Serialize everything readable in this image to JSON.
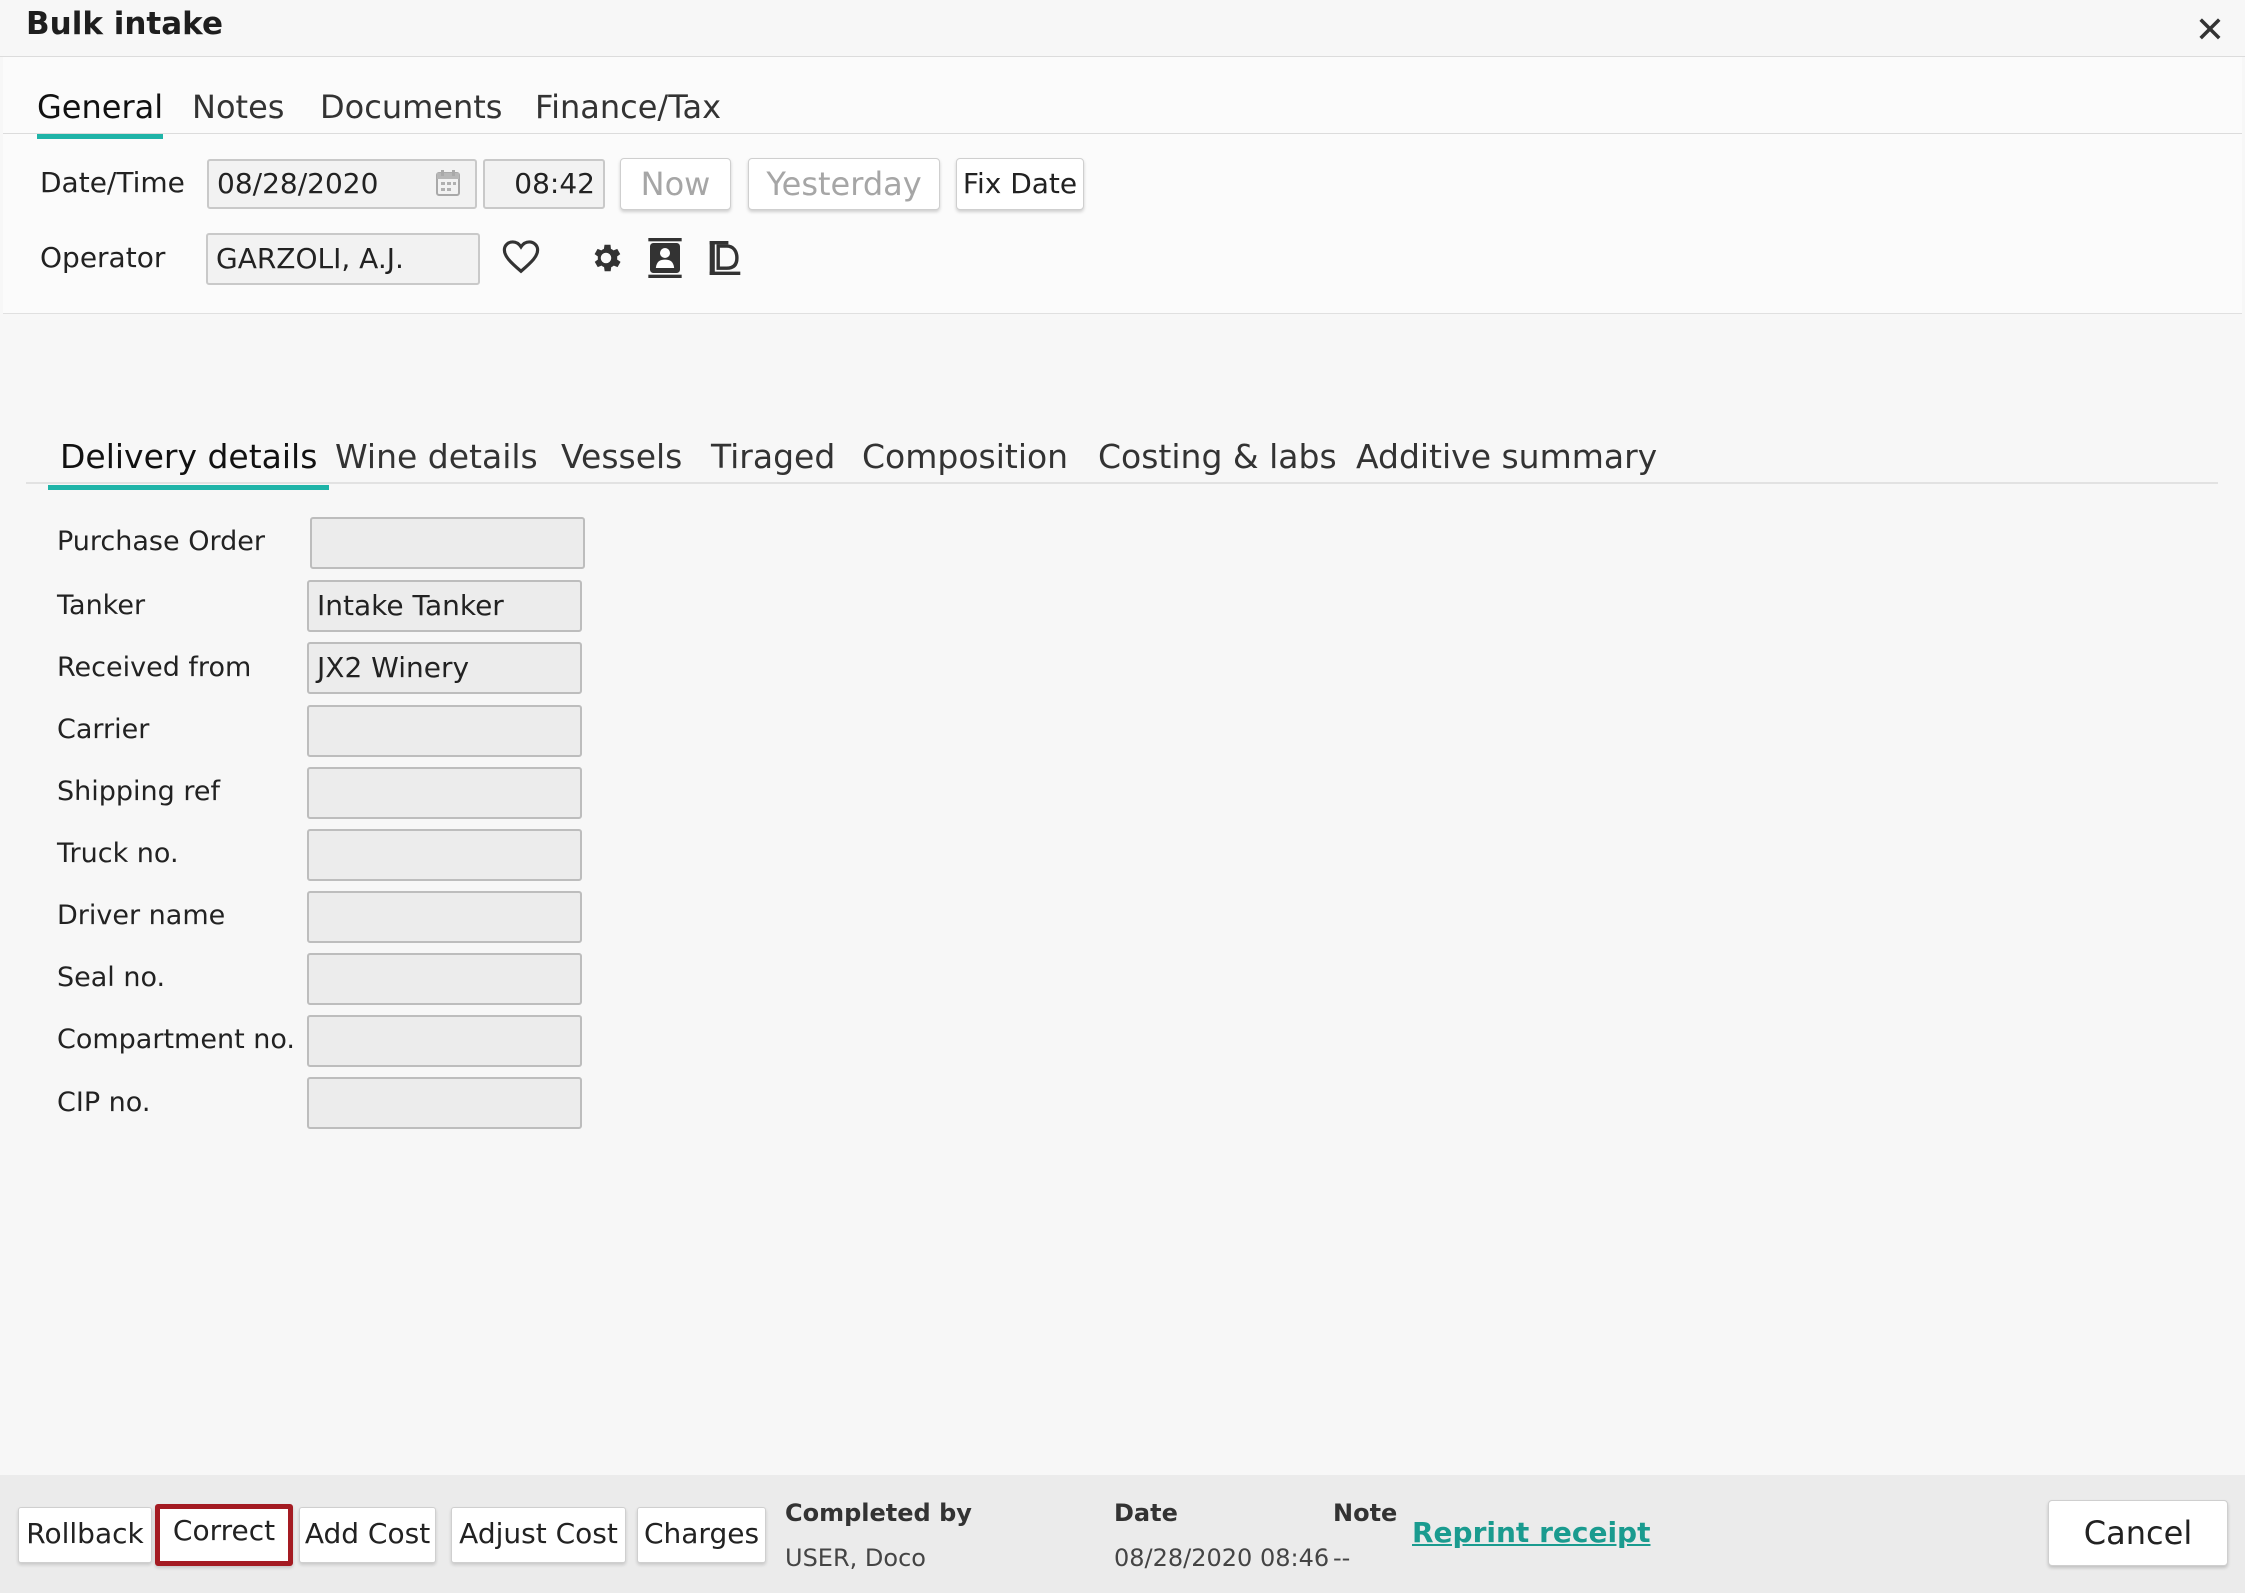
{
  "window": {
    "title": "Bulk intake",
    "close_glyph": "✕"
  },
  "tabs": [
    {
      "label": "General"
    },
    {
      "label": "Notes"
    },
    {
      "label": "Documents"
    },
    {
      "label": "Finance/Tax"
    }
  ],
  "general": {
    "datetime_label": "Date/Time",
    "date_value": "08/28/2020",
    "time_value": "08:42",
    "now_label": "Now",
    "yesterday_label": "Yesterday",
    "fix_date_label": "Fix Date",
    "operator_label": "Operator",
    "operator_value": "GARZOLI, A.J.",
    "icons": [
      "calendar-icon",
      "heart-icon",
      "gear-icon",
      "contact-card-icon",
      "document-icon"
    ]
  },
  "subtabs": [
    {
      "label": "Delivery details"
    },
    {
      "label": "Wine details"
    },
    {
      "label": "Vessels"
    },
    {
      "label": "Tiraged"
    },
    {
      "label": "Composition"
    },
    {
      "label": "Costing & labs"
    },
    {
      "label": "Additive summary"
    }
  ],
  "delivery": [
    {
      "label": "Purchase Order",
      "value": ""
    },
    {
      "label": "Tanker",
      "value": "Intake Tanker"
    },
    {
      "label": "Received from",
      "value": "JX2 Winery"
    },
    {
      "label": "Carrier",
      "value": ""
    },
    {
      "label": "Shipping ref",
      "value": ""
    },
    {
      "label": "Truck no.",
      "value": ""
    },
    {
      "label": "Driver name",
      "value": ""
    },
    {
      "label": "Seal no.",
      "value": ""
    },
    {
      "label": "Compartment no.",
      "value": ""
    },
    {
      "label": "CIP no.",
      "value": ""
    }
  ],
  "footer": {
    "rollback_label": "Rollback",
    "correct_label": "Correct",
    "add_cost_label": "Add Cost",
    "adjust_cost_label": "Adjust Cost",
    "charges_label": "Charges",
    "completed_by_label": "Completed by",
    "completed_by_value": "USER, Doco",
    "date_label": "Date",
    "date_value": "08/28/2020 08:46",
    "note_label": "Note",
    "note_value": "--",
    "reprint_label": "Reprint receipt",
    "cancel_label": "Cancel"
  },
  "colors": {
    "accent": "#1fb4a8",
    "highlight_border": "#a41b22",
    "link": "#1a9b8f"
  }
}
